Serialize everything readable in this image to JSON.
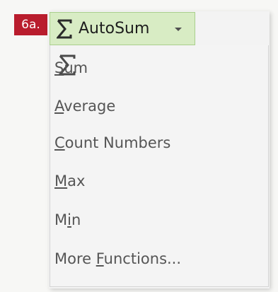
{
  "step": {
    "label": "6a."
  },
  "autosum": {
    "label": "AutoSum",
    "icon": "sigma-icon",
    "dropdown_icon": "caret-down-icon",
    "highlight_color": "#d8ecc4"
  },
  "menu": {
    "items": [
      {
        "id": "sum",
        "prefix": "",
        "accel": "S",
        "suffix": "um",
        "full": "Sum",
        "icon": "sigma-icon"
      },
      {
        "id": "average",
        "prefix": "",
        "accel": "A",
        "suffix": "verage",
        "full": "Average"
      },
      {
        "id": "count-numbers",
        "prefix": "",
        "accel": "C",
        "suffix": "ount Numbers",
        "full": "Count Numbers"
      },
      {
        "id": "max",
        "prefix": "",
        "accel": "M",
        "suffix": "ax",
        "full": "Max"
      },
      {
        "id": "min",
        "prefix": "M",
        "accel": "i",
        "suffix": "n",
        "full": "Min"
      },
      {
        "id": "more-functions",
        "prefix": "More ",
        "accel": "F",
        "suffix": "unctions...",
        "full": "More Functions..."
      }
    ]
  },
  "colors": {
    "badge": "#b91d2d",
    "menu_text": "#555555"
  }
}
